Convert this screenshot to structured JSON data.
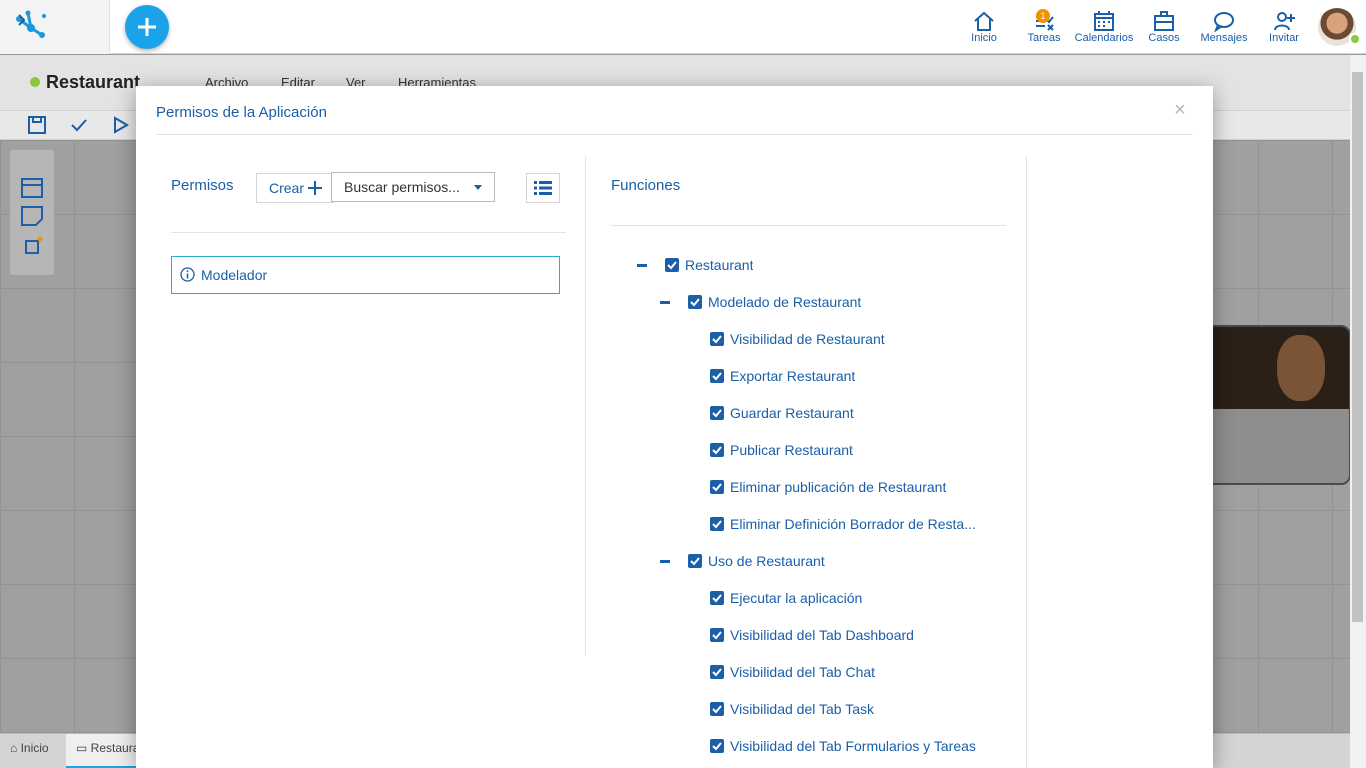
{
  "header": {
    "nav": [
      {
        "label": "Inicio",
        "icon": "home-icon"
      },
      {
        "label": "Tareas",
        "icon": "tasks-icon",
        "badge": "1"
      },
      {
        "label": "Calendarios",
        "icon": "calendar-icon"
      },
      {
        "label": "Casos",
        "icon": "briefcase-icon"
      },
      {
        "label": "Mensajes",
        "icon": "chat-icon"
      },
      {
        "label": "Invitar",
        "icon": "add-user-icon"
      }
    ]
  },
  "app": {
    "title": "Restaurant",
    "menus": [
      "Archivo",
      "Editar",
      "Ver",
      "Herramientas"
    ]
  },
  "bottom_tabs": [
    "Inicio",
    "Restaura"
  ],
  "modal": {
    "title": "Permisos de la Aplicación",
    "close": "×",
    "permissions": {
      "label": "Permisos",
      "create_label": "Crear",
      "search_placeholder": "Buscar permisos...",
      "items": [
        {
          "name": "Modelador"
        }
      ]
    },
    "functions": {
      "label": "Funciones",
      "tree": [
        {
          "label": "Restaurant",
          "level": 0,
          "checked": true,
          "expanded": true
        },
        {
          "label": "Modelado de Restaurant",
          "level": 1,
          "checked": true,
          "expanded": true
        },
        {
          "label": "Visibilidad de Restaurant",
          "level": 2,
          "checked": true
        },
        {
          "label": "Exportar Restaurant",
          "level": 2,
          "checked": true
        },
        {
          "label": "Guardar Restaurant",
          "level": 2,
          "checked": true
        },
        {
          "label": "Publicar Restaurant",
          "level": 2,
          "checked": true
        },
        {
          "label": "Eliminar publicación de Restaurant",
          "level": 2,
          "checked": true
        },
        {
          "label": "Eliminar Definición Borrador de Resta...",
          "level": 2,
          "checked": true
        },
        {
          "label": "Uso de Restaurant",
          "level": 1,
          "checked": true,
          "expanded": true
        },
        {
          "label": "Ejecutar la aplicación",
          "level": 2,
          "checked": true
        },
        {
          "label": "Visibilidad del Tab Dashboard",
          "level": 2,
          "checked": true
        },
        {
          "label": "Visibilidad del Tab Chat",
          "level": 2,
          "checked": true
        },
        {
          "label": "Visibilidad del Tab Task",
          "level": 2,
          "checked": true
        },
        {
          "label": "Visibilidad del Tab Formularios y Tareas",
          "level": 2,
          "checked": true
        }
      ]
    }
  },
  "colors": {
    "primary": "#1a5fa8",
    "fab": "#1aa3e8",
    "badge": "#f29100",
    "online": "#8dc63f",
    "selection_border": "#2ab0c6"
  }
}
